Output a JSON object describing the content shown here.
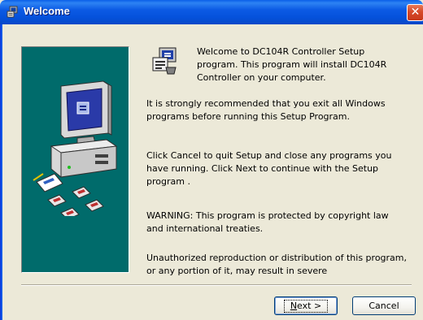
{
  "window": {
    "title": "Welcome",
    "title_icon": "setup-icon",
    "close_glyph": "✕"
  },
  "content": {
    "intro": "Welcome to DC104R Controller Setup program. This program will install DC104R Controller on your computer.",
    "paragraph1": "It is strongly recommended that you exit all Windows programs before running this Setup Program.",
    "paragraph2": "Click Cancel to quit Setup and close any programs you have running.  Click Next to continue with the Setup program .",
    "paragraph3": "WARNING: This program is protected by copyright law and international treaties.",
    "paragraph4": "Unauthorized reproduction or distribution of this program, or any portion of it, may result in severe"
  },
  "buttons": {
    "next_mnemonic": "N",
    "next_rest": "ext >",
    "cancel": "Cancel"
  },
  "colors": {
    "titlebar": "#0552dc",
    "panel": "#006b6b",
    "dialog_bg": "#ece9d8",
    "close": "#d6492a"
  }
}
